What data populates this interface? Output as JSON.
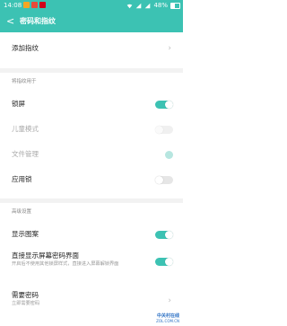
{
  "status_bar": {
    "time": "14:08",
    "battery": "48%",
    "notification_colors": [
      "#f5a623",
      "#e84a3a",
      "#d0021b"
    ]
  },
  "header": {
    "back_glyph": "<",
    "title": "密码和指纹"
  },
  "add_fingerprint": {
    "label": "添加指纹"
  },
  "fingerprint_usage": {
    "section_label": "将指纹用于",
    "items": [
      {
        "label": "锁屏",
        "state": "on",
        "enabled": true
      },
      {
        "label": "儿童模式",
        "state": "off",
        "enabled": false
      },
      {
        "label": "文件管理",
        "state": "on",
        "enabled": false
      },
      {
        "label": "应用锁",
        "state": "off",
        "enabled": true
      }
    ]
  },
  "advanced": {
    "section_label": "高级设置",
    "show_pattern": {
      "label": "显示图案",
      "state": "on"
    },
    "direct_show": {
      "label": "直接显示屏幕密码界面",
      "subtitle": "开启后不使用其他锁屏样式，直接进入屏幕解锁界面",
      "state": "on"
    },
    "require_password": {
      "label": "需要密码",
      "subtitle": "立即需要密码"
    }
  },
  "watermark": {
    "line1": "中关村在线",
    "line2": "ZOL.COM.CN"
  },
  "colors": {
    "accent": "#3cc2b3"
  }
}
